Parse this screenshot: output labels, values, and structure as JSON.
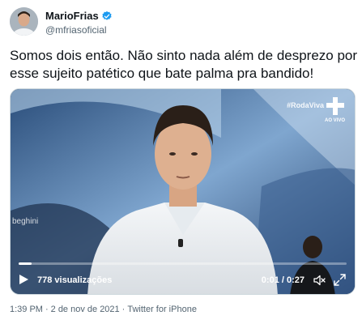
{
  "author": {
    "display_name": "MarioFrias",
    "handle": "@mfriasoficial",
    "verified_badge_color": "#1d9bf0"
  },
  "tweet": {
    "text": "Somos dois então. Não sinto nada além de desprezo por esse sujeito patético que bate palma pra bandido!"
  },
  "video": {
    "hashtag": "#RodaViva",
    "live_label": "AO VIVO",
    "lower_third_name": "beghini",
    "views": "778 visualizações",
    "time": "0:01 / 0:27",
    "progress": 0.04
  },
  "meta": {
    "time": "1:39 PM",
    "separator": "·",
    "date": "2 de nov de 2021",
    "source": "Twitter for iPhone"
  },
  "icons": {
    "verified": "verified-badge-icon",
    "play": "play-icon",
    "mute": "speaker-muted-icon",
    "fullscreen": "fullscreen-icon"
  }
}
